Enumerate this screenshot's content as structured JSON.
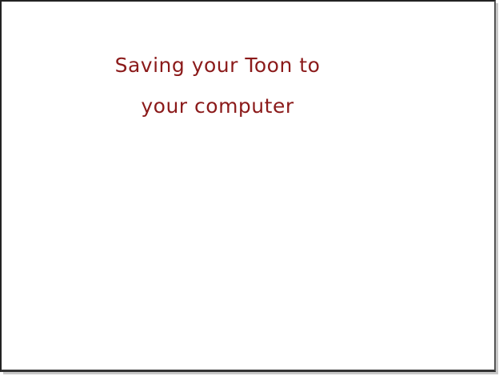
{
  "slide": {
    "title_line_1": "Saving your Toon to",
    "title_line_2": "your computer"
  },
  "colors": {
    "title_text": "#8b1a1a",
    "background": "#ffffff",
    "border": "#222222"
  }
}
